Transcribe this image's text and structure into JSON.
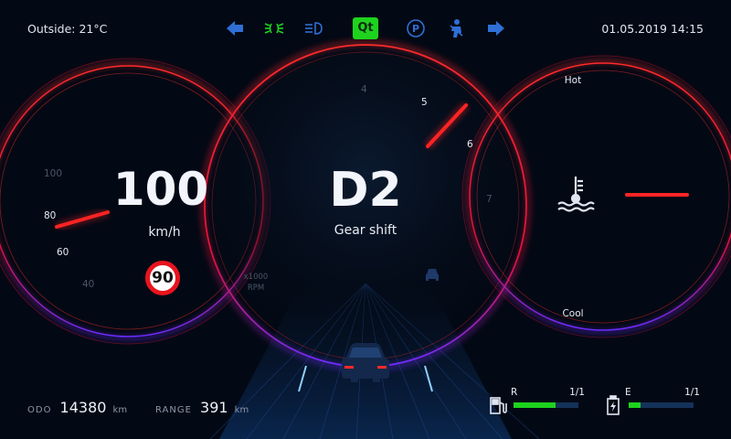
{
  "status": {
    "outside": "Outside: 21°C",
    "datetime": "01.05.2019  14:15",
    "qt_logo": "Qt",
    "telltales": [
      "turn-left-icon",
      "parking-lights-icon",
      "headlight-icon",
      "qt-logo",
      "parking-brake-icon",
      "seatbelt-icon",
      "turn-right-icon"
    ]
  },
  "speedometer": {
    "speed": "100",
    "unit": "km/h",
    "ticks": [
      "100",
      "80",
      "60",
      "40"
    ],
    "speed_limit": "90"
  },
  "tachometer": {
    "gear": "D2",
    "gear_label": "Gear shift",
    "ticks": [
      "4",
      "5",
      "6",
      "7"
    ],
    "unit_line1": "x1000",
    "unit_line2": "RPM"
  },
  "temperature": {
    "hot_label": "Hot",
    "cool_label": "Cool"
  },
  "trip": {
    "odo_label": "ODO",
    "odo_value": "14380",
    "odo_unit": "km",
    "range_label": "RANGE",
    "range_value": "391",
    "range_unit": "km"
  },
  "fuel": {
    "label": "R",
    "ratio": "1/1",
    "level": 0.65
  },
  "battery": {
    "label": "E",
    "ratio": "1/1",
    "level": 0.18
  },
  "colors": {
    "accent_red": "#ff2424",
    "indicator_green": "#1ed31e",
    "arrow_blue": "#2f6fd6"
  }
}
